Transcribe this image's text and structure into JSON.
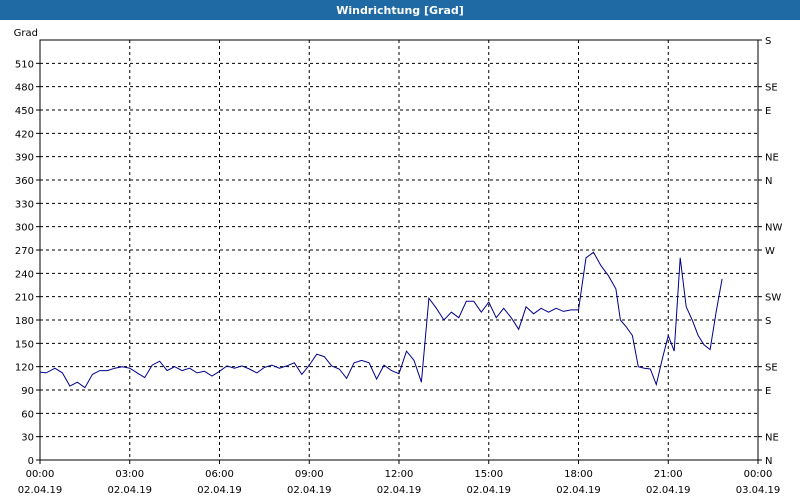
{
  "window": {
    "title": "Windrichtung [Grad]"
  },
  "chart_data": {
    "type": "line",
    "title": "Windrichtung [Grad]",
    "ylabel": "Grad",
    "ylim": [
      0,
      540
    ],
    "xlim_hours": [
      0,
      24
    ],
    "yticks": [
      0,
      30,
      60,
      90,
      120,
      150,
      180,
      210,
      240,
      270,
      300,
      330,
      360,
      390,
      420,
      450,
      480,
      510
    ],
    "right_ticks": [
      {
        "value": 0,
        "label": "N"
      },
      {
        "value": 30,
        "label": "NE"
      },
      {
        "value": 90,
        "label": "E"
      },
      {
        "value": 120,
        "label": "SE"
      },
      {
        "value": 180,
        "label": "S"
      },
      {
        "value": 210,
        "label": "SW"
      },
      {
        "value": 270,
        "label": "W"
      },
      {
        "value": 300,
        "label": "NW"
      },
      {
        "value": 360,
        "label": "N"
      },
      {
        "value": 390,
        "label": "NE"
      },
      {
        "value": 450,
        "label": "E"
      },
      {
        "value": 480,
        "label": "SE"
      },
      {
        "value": 540,
        "label": "S"
      }
    ],
    "xticks": [
      {
        "hour": 0,
        "time": "00:00",
        "date": "02.04.19"
      },
      {
        "hour": 3,
        "time": "03:00",
        "date": "02.04.19"
      },
      {
        "hour": 6,
        "time": "06:00",
        "date": "02.04.19"
      },
      {
        "hour": 9,
        "time": "09:00",
        "date": "02.04.19"
      },
      {
        "hour": 12,
        "time": "12:00",
        "date": "02.04.19"
      },
      {
        "hour": 15,
        "time": "15:00",
        "date": "02.04.19"
      },
      {
        "hour": 18,
        "time": "18:00",
        "date": "02.04.19"
      },
      {
        "hour": 21,
        "time": "21:00",
        "date": "02.04.19"
      },
      {
        "hour": 24,
        "time": "00:00",
        "date": "03.04.19"
      }
    ],
    "grid": true,
    "color": "#00008b",
    "series": [
      {
        "hours": [
          0.0,
          0.2,
          0.5,
          0.75,
          1.0,
          1.25,
          1.5,
          1.75,
          2.0,
          2.25,
          2.5,
          2.75,
          3.0,
          3.25,
          3.5,
          3.75,
          4.0,
          4.25,
          4.5,
          4.75,
          5.0,
          5.25,
          5.5,
          5.75,
          6.0,
          6.25,
          6.5,
          6.75,
          7.0,
          7.25,
          7.5,
          7.75,
          8.0,
          8.25,
          8.5,
          8.75,
          9.0,
          9.25,
          9.5,
          9.75,
          10.0,
          10.25,
          10.5,
          10.75,
          11.0,
          11.25,
          11.5,
          11.75,
          12.0,
          12.25,
          12.5,
          12.75,
          13.0,
          13.25,
          13.5,
          13.75,
          14.0,
          14.25,
          14.5,
          14.75,
          15.0,
          15.25,
          15.5,
          15.75,
          16.0,
          16.25,
          16.5,
          16.75,
          17.0,
          17.25,
          17.5,
          17.75,
          18.0,
          18.25,
          18.5,
          18.75,
          19.0,
          19.25,
          19.4,
          19.6,
          19.8,
          20.0,
          20.2,
          20.4,
          20.6,
          20.8,
          21.0,
          21.2,
          21.4,
          21.6,
          21.8,
          22.0,
          22.2,
          22.4,
          22.6,
          22.8,
          23.0,
          23.2,
          23.4,
          23.6,
          23.8,
          24.0
        ],
        "values": [
          113,
          112,
          118,
          112,
          95,
          100,
          93,
          110,
          115,
          115,
          118,
          120,
          118,
          112,
          106,
          122,
          127,
          115,
          120,
          115,
          118,
          112,
          114,
          108,
          114,
          121,
          118,
          121,
          117,
          112,
          119,
          122,
          118,
          121,
          125,
          110,
          122,
          136,
          133,
          121,
          117,
          105,
          125,
          128,
          125,
          104,
          122,
          115,
          111,
          140,
          128,
          100,
          208,
          195,
          180,
          190,
          183,
          204,
          204,
          190,
          203,
          183,
          195,
          183,
          168,
          197,
          188,
          195,
          190,
          195,
          191,
          193,
          193,
          260,
          267,
          250,
          237,
          220,
          180,
          171,
          160,
          120,
          118,
          117,
          97,
          130,
          160,
          140,
          260,
          197,
          180,
          160,
          148,
          142,
          190,
          233
        ]
      }
    ]
  }
}
